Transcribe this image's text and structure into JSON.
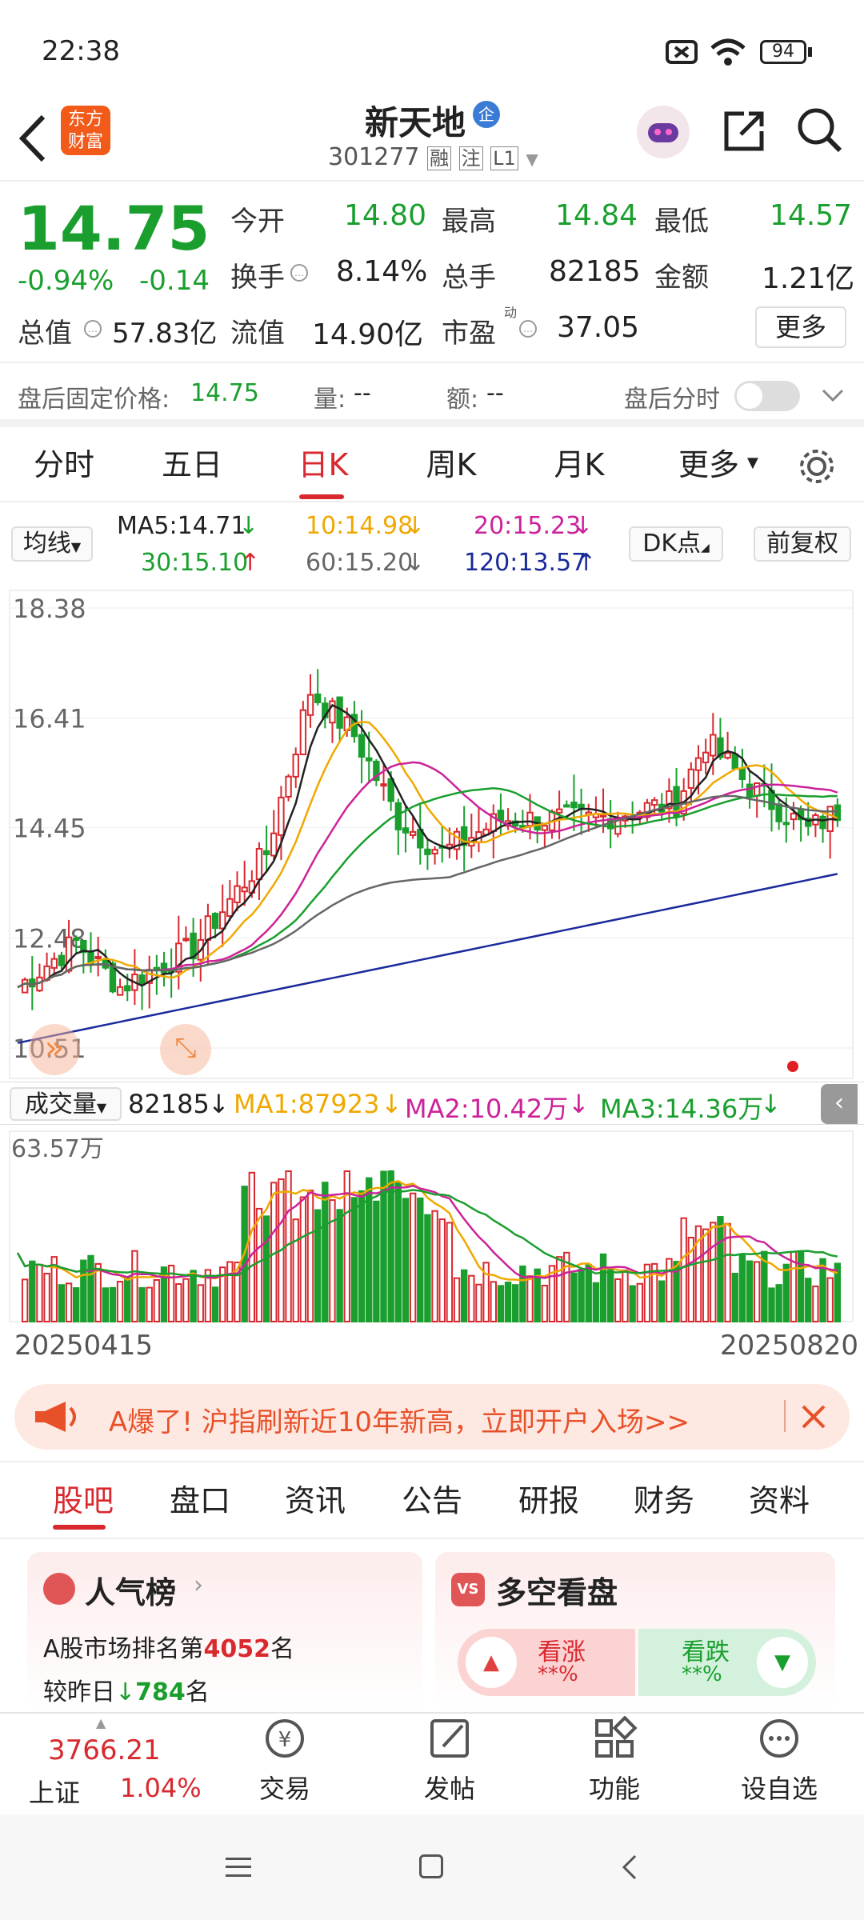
{
  "status": {
    "time": "22:38",
    "battery": "94"
  },
  "header": {
    "name": "新天地",
    "badge": "企",
    "code": "301277",
    "tag1": "融",
    "tag2": "注",
    "tag3": "L1",
    "logo_line1": "东方",
    "logo_line2": "财富"
  },
  "quote": {
    "price": "14.75",
    "change_pct": "-0.94%",
    "change_abs": "-0.14",
    "open_label": "今开",
    "open": "14.80",
    "high_label": "最高",
    "high": "14.84",
    "low_label": "最低",
    "low": "14.57",
    "turnover_label": "换手",
    "turnover": "8.14%",
    "vol_label": "总手",
    "vol": "82185",
    "amount_label": "金额",
    "amount": "1.21亿",
    "mcap_label": "总值",
    "mcap": "57.83亿",
    "float_label": "流值",
    "float": "14.90亿",
    "pe_label": "市盈",
    "pe_sup": "动",
    "pe": "37.05",
    "more": "更多"
  },
  "after_hours": {
    "label": "盘后固定价格:",
    "price": "14.75",
    "vol_label": "量:",
    "vol": "--",
    "amt_label": "额:",
    "amt": "--",
    "timeshare_label": "盘后分时"
  },
  "tabs": [
    "分时",
    "五日",
    "日K",
    "周K",
    "月K",
    "更多"
  ],
  "ma": {
    "selector": "均线",
    "ma5": "MA5:14.71",
    "ma10": "10:14.98",
    "ma20": "20:15.23",
    "ma30": "30:15.10",
    "ma60": "60:15.20",
    "ma120": "120:13.57",
    "dk": "DK点",
    "adjust": "前复权"
  },
  "price_axis": [
    "18.38",
    "16.41",
    "14.45",
    "12.48",
    "10.51"
  ],
  "vol_bar": {
    "selector": "成交量",
    "value": "82185",
    "ma1": "MA1:87923",
    "ma2": "MA2:10.42万",
    "ma3": "MA3:14.36万",
    "max": "63.57万",
    "date_start": "20250415",
    "date_end": "20250820"
  },
  "colors": {
    "up": "#d8292f",
    "down": "#1a9f2e",
    "ma5": "#222222",
    "ma10": "#f0a800",
    "ma20": "#cc2299",
    "ma30": "#1a9f2e",
    "ma60": "#666666",
    "ma120": "#1a2a9a"
  },
  "banner": {
    "text": "A爆了! 沪指刷新近10年新高，立即开户入场>>"
  },
  "news_tabs": [
    "股吧",
    "盘口",
    "资讯",
    "公告",
    "研报",
    "财务",
    "资料"
  ],
  "cards": {
    "popularity_title": "人气榜",
    "rank_prefix": "A股市场排名第",
    "rank": "4052",
    "rank_suffix": "名",
    "prev_prefix": "较昨日",
    "prev_change": "784",
    "prev_suffix": "名",
    "bullbear_title": "多空看盘",
    "bull_label": "看涨",
    "bull_pct": "**%",
    "bear_label": "看跌",
    "bear_pct": "**%"
  },
  "bottom": {
    "index_value": "3766.21",
    "index_name": "上证",
    "index_pct": "1.04%",
    "trade": "交易",
    "post": "发帖",
    "func": "功能",
    "watch": "设自选"
  }
}
